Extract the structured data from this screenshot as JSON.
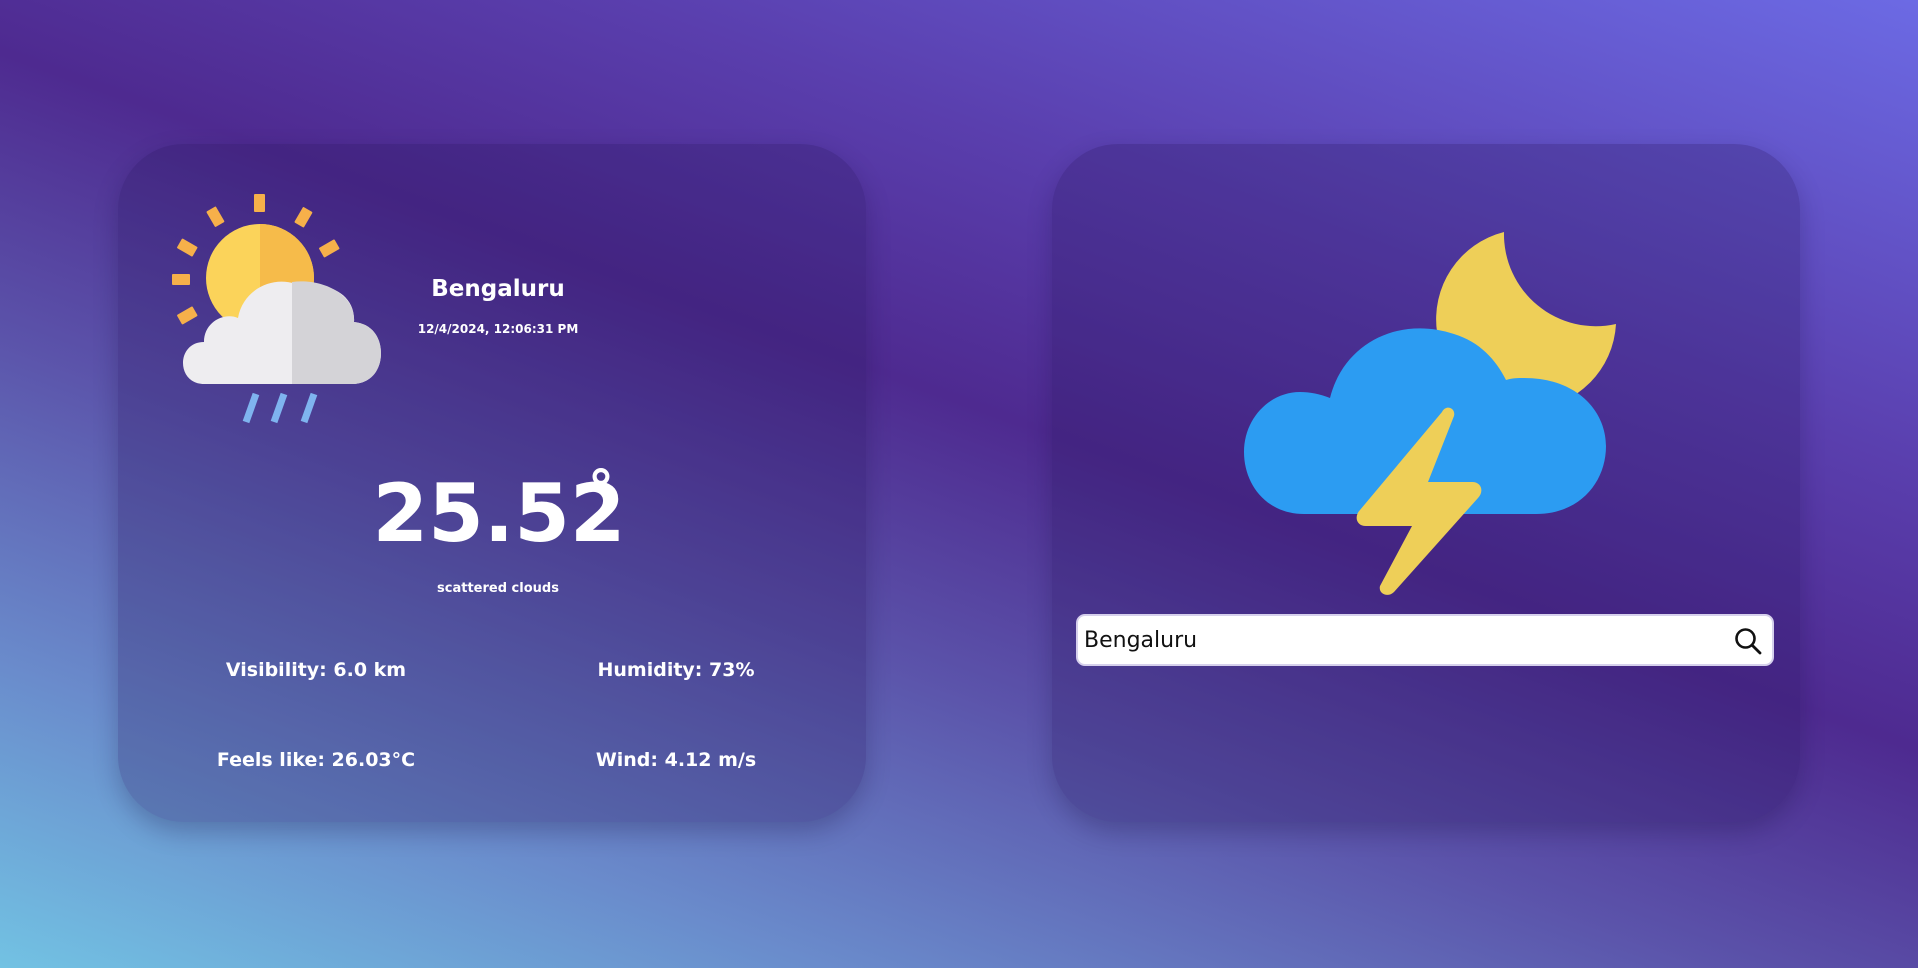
{
  "weather": {
    "city": "Bengaluru",
    "datetime": "12/4/2024, 12:06:31 PM",
    "temperature": "25.52",
    "degree_symbol": "°",
    "description": "scattered clouds",
    "icon": "partly-cloudy-rain-icon"
  },
  "stats": {
    "visibility": "Visibility: 6.0 km",
    "humidity": "Humidity: 73%",
    "feels_like": "Feels like: 26.03°C",
    "wind": "Wind: 4.12 m/s"
  },
  "search": {
    "value": "Bengaluru",
    "icon": "search-icon",
    "illustration": "moon-cloud-lightning-icon"
  },
  "colors": {
    "sun": "#f6c24a",
    "cloud": "#2d9cf1",
    "moon": "#eecf58",
    "bolt": "#eecf58"
  }
}
